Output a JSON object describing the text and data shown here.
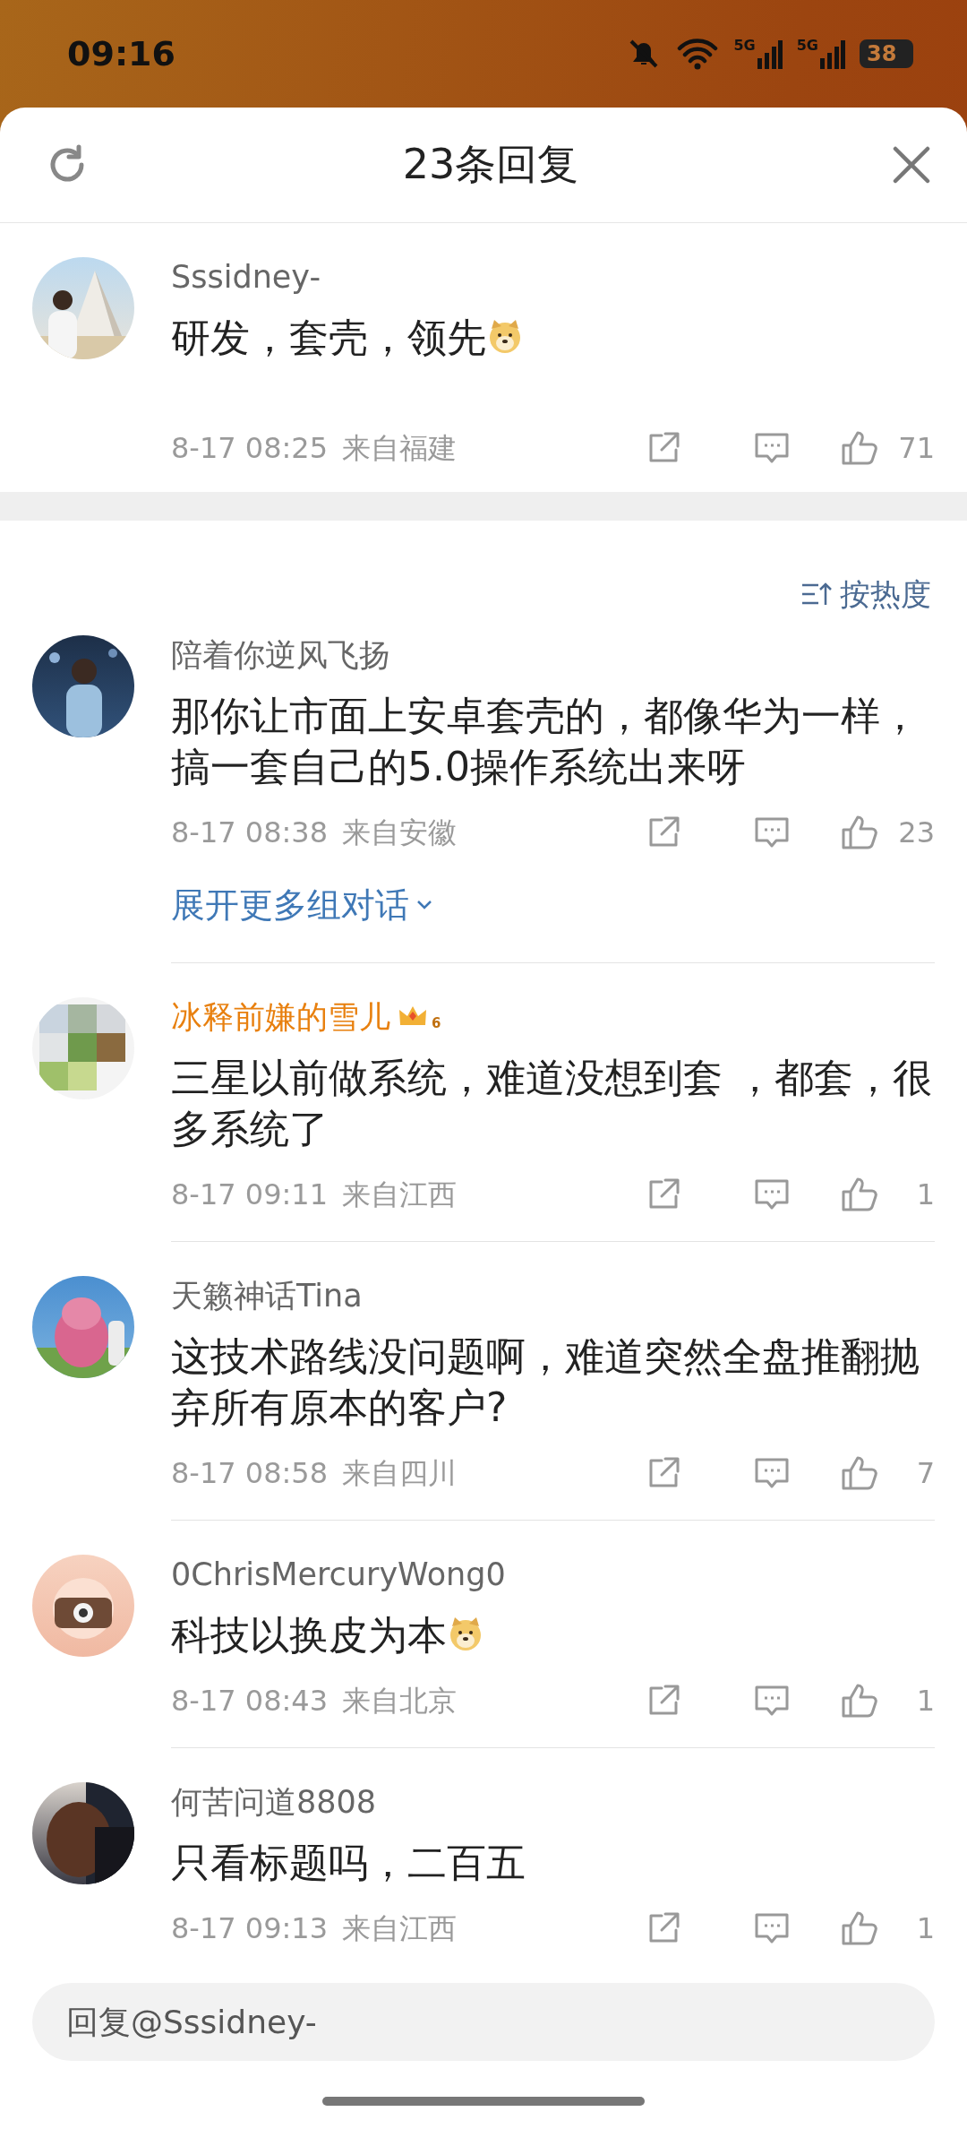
{
  "status_bar": {
    "time": "09:16",
    "networks": [
      "5G",
      "5G"
    ],
    "battery": "38"
  },
  "header": {
    "title": "23条回复"
  },
  "root_comment": {
    "user": "Sssidney-",
    "vip": false,
    "text": "研发，套壳，领先",
    "emoji": true,
    "date": "8-17 08:25",
    "location": "来自福建",
    "likes": "71"
  },
  "sort": {
    "label": "按热度"
  },
  "comments": [
    {
      "user": "陪着你逆风飞扬",
      "vip": false,
      "text": "那你让市面上安卓套壳的，都像华为一样，搞一套自己的5.0操作系统出来呀",
      "emoji": false,
      "date": "8-17 08:38",
      "location": "来自安徽",
      "likes": "23",
      "more": "展开更多组对话"
    },
    {
      "user": "冰释前嫌的雪儿",
      "vip": true,
      "vip_level": "6",
      "text": "三星以前做系统，难道没想到套 ，都套，很多系统了",
      "emoji": false,
      "date": "8-17 09:11",
      "location": "来自江西",
      "likes": "1"
    },
    {
      "user": "天籁神话Tina",
      "vip": false,
      "text": "这技术路线没问题啊，难道突然全盘推翻抛弃所有原本的客户?",
      "emoji": false,
      "date": "8-17 08:58",
      "location": "来自四川",
      "likes": "7"
    },
    {
      "user": "0ChrisMercuryWong0",
      "vip": false,
      "text": "科技以换皮为本",
      "emoji": true,
      "date": "8-17 08:43",
      "location": "来自北京",
      "likes": "1"
    },
    {
      "user": "何苦问道8808",
      "vip": false,
      "text": "只看标题吗，二百五",
      "emoji": false,
      "date": "8-17 09:13",
      "location": "来自江西",
      "likes": "1"
    }
  ],
  "reply_box": {
    "placeholder": "回复@Sssidney-"
  }
}
